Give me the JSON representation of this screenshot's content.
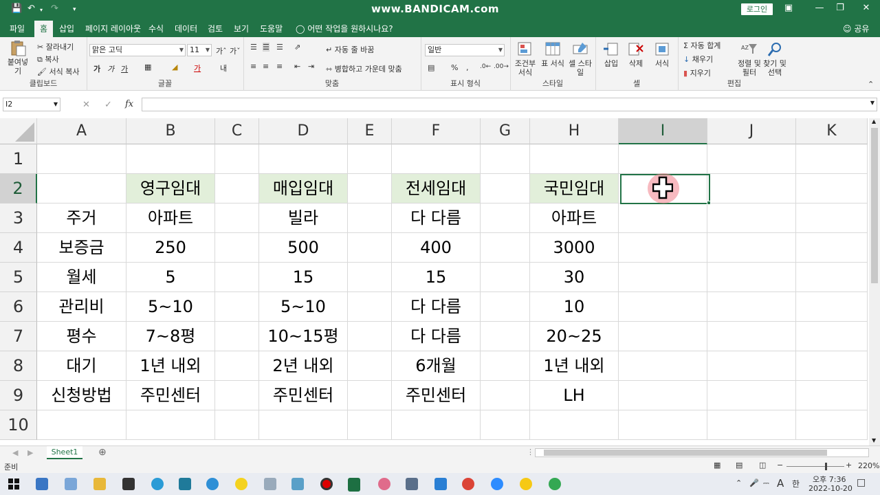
{
  "titlebar": {
    "watermark": "www.BANDICAM.com",
    "login": "로그인"
  },
  "menu": {
    "tabs": [
      "파일",
      "홈",
      "삽입",
      "페이지 레이아웃",
      "수식",
      "데이터",
      "검토",
      "보기",
      "도움말"
    ],
    "tell_me": "어떤 작업을 원하시나요?",
    "share": "공유"
  },
  "ribbon": {
    "clipboard": {
      "paste": "붙여넣기",
      "cut": "잘라내기",
      "copy": "복사",
      "format_painter": "서식 복사",
      "label": "클립보드"
    },
    "font": {
      "name": "맑은 고딕",
      "size": "11",
      "bold": "가",
      "italic": "가",
      "underline": "가",
      "label": "글꼴"
    },
    "alignment": {
      "wrap": "자동 줄 바꿈",
      "merge": "병합하고 가운데 맞춤",
      "label": "맞춤"
    },
    "number": {
      "format": "일반",
      "percent": "%",
      "comma": ",",
      "label": "표시 형식"
    },
    "styles": {
      "conditional": "조건부 서식",
      "table": "표 서식",
      "cell": "셀 스타일",
      "label": "스타일"
    },
    "cells": {
      "insert": "삽입",
      "delete": "삭제",
      "format": "서식",
      "label": "셀"
    },
    "editing": {
      "autosum": "자동 합계",
      "fill": "채우기",
      "clear": "지우기",
      "sort": "정렬 및 필터",
      "find": "찾기 및 선택",
      "label": "편집"
    }
  },
  "formula_bar": {
    "name_box": "I2",
    "fx": "fx",
    "value": ""
  },
  "sheet": {
    "columns": [
      "A",
      "B",
      "C",
      "D",
      "E",
      "F",
      "G",
      "H",
      "I",
      "J",
      "K"
    ],
    "selected_column": "I",
    "selected_row": "2",
    "rows": [
      {
        "num": "1",
        "cells": [
          "",
          "",
          "",
          "",
          "",
          "",
          "",
          "",
          "",
          "",
          ""
        ]
      },
      {
        "num": "2",
        "cells": [
          "",
          "영구임대",
          "",
          "매입임대",
          "",
          "전세임대",
          "",
          "국민임대",
          "",
          "",
          ""
        ]
      },
      {
        "num": "3",
        "cells": [
          "주거",
          "아파트",
          "",
          "빌라",
          "",
          "다 다름",
          "",
          "아파트",
          "",
          "",
          ""
        ]
      },
      {
        "num": "4",
        "cells": [
          "보증금",
          "250",
          "",
          "500",
          "",
          "400",
          "",
          "3000",
          "",
          "",
          ""
        ]
      },
      {
        "num": "5",
        "cells": [
          "월세",
          "5",
          "",
          "15",
          "",
          "15",
          "",
          "30",
          "",
          "",
          ""
        ]
      },
      {
        "num": "6",
        "cells": [
          "관리비",
          "5~10",
          "",
          "5~10",
          "",
          "다 다름",
          "",
          "10",
          "",
          "",
          ""
        ]
      },
      {
        "num": "7",
        "cells": [
          "평수",
          "7~8평",
          "",
          "10~15평",
          "",
          "다 다름",
          "",
          "20~25",
          "",
          "",
          ""
        ]
      },
      {
        "num": "8",
        "cells": [
          "대기",
          "1년 내외",
          "",
          "2년 내외",
          "",
          "6개월",
          "",
          "1년 내외",
          "",
          "",
          ""
        ]
      },
      {
        "num": "9",
        "cells": [
          "신청방법",
          "주민센터",
          "",
          "주민센터",
          "",
          "주민센터",
          "",
          "LH",
          "",
          "",
          ""
        ]
      },
      {
        "num": "10",
        "cells": [
          "",
          "",
          "",
          "",
          "",
          "",
          "",
          "",
          "",
          "",
          ""
        ]
      }
    ]
  },
  "sheet_tab": "Sheet1",
  "status": {
    "ready": "준비",
    "zoom": "220%"
  },
  "taskbar": {
    "time": "오후 7:36",
    "date": "2022-10-20",
    "ime": "한",
    "lang": "A"
  },
  "colors": {
    "excel_green": "#217346",
    "header_fill": "#e2efda"
  }
}
